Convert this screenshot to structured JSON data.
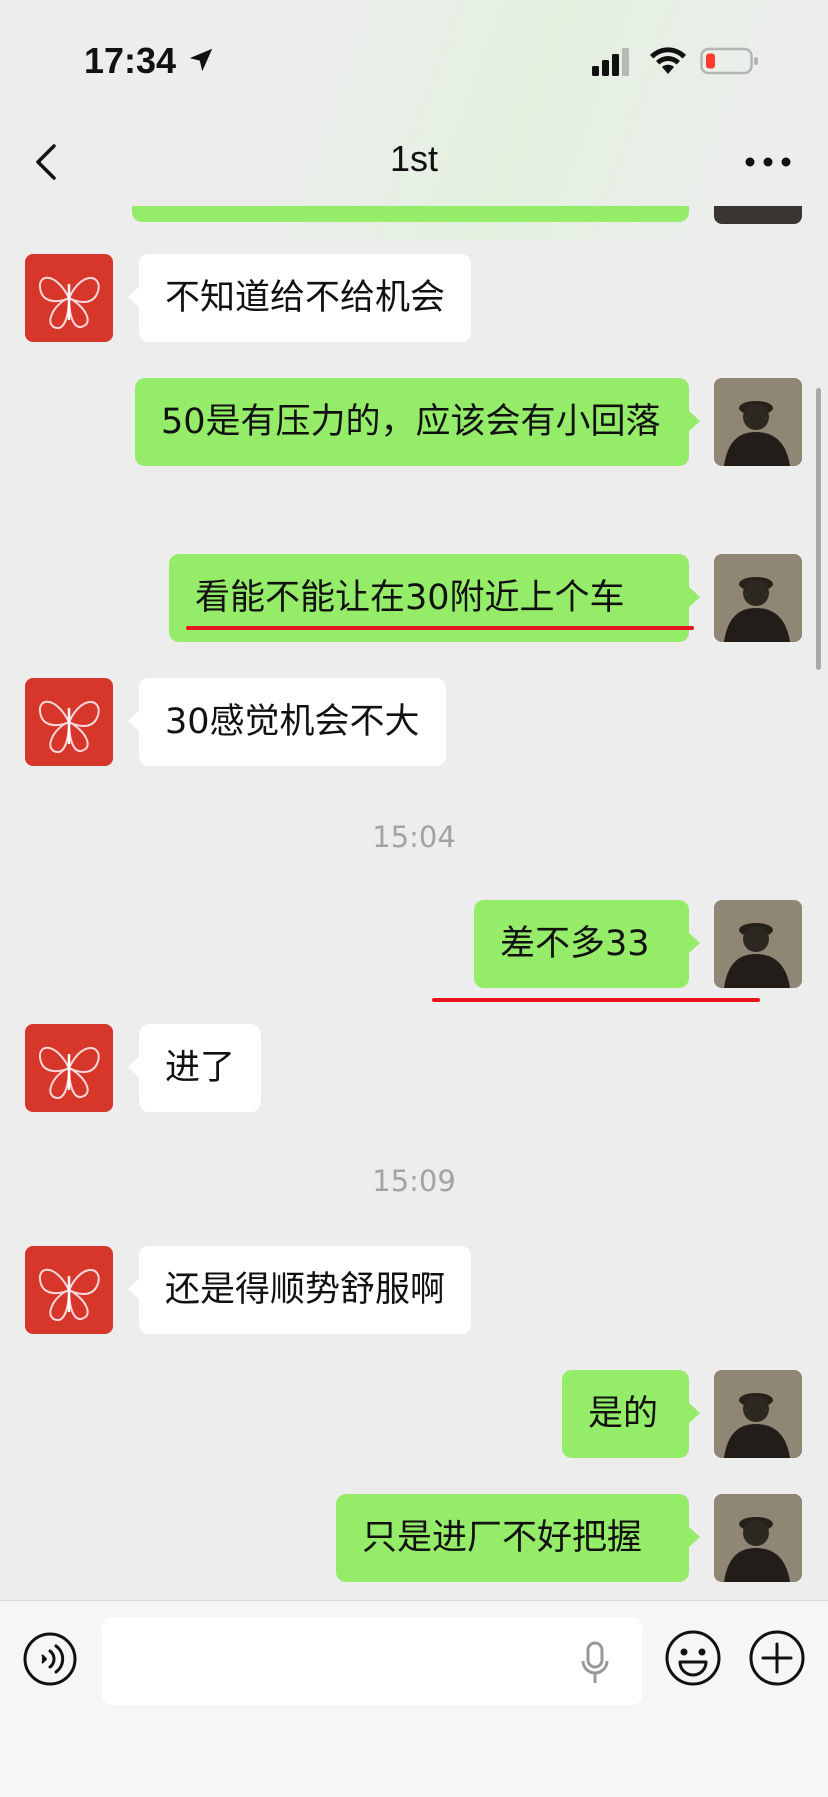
{
  "status_bar": {
    "time": "17:34"
  },
  "nav": {
    "title": "1st"
  },
  "messages": [
    {
      "text": "不知道给不给机会"
    },
    {
      "text": "50是有压力的，应该会有小回落"
    },
    {
      "text": "看能不能让在30附近上个车"
    },
    {
      "text": "30感觉机会不大"
    },
    {
      "text": "差不多33"
    },
    {
      "text": "进了"
    },
    {
      "text": "还是得顺势舒服啊"
    },
    {
      "text": "是的"
    },
    {
      "text": "只是进厂不好把握"
    }
  ],
  "timestamps": [
    "15:04",
    "15:09"
  ],
  "input": {
    "value": "",
    "placeholder": ""
  },
  "colors": {
    "outgoing_bubble": "#95ec69",
    "incoming_bubble": "#ffffff",
    "background": "#ededed",
    "annotation_underline": "#e8141c"
  },
  "icons": {
    "back": "chevron-left-icon",
    "more": "more-dots-icon",
    "voice": "voice-mode-icon",
    "mic": "mic-icon",
    "emoji": "emoji-icon",
    "plus": "plus-icon"
  }
}
